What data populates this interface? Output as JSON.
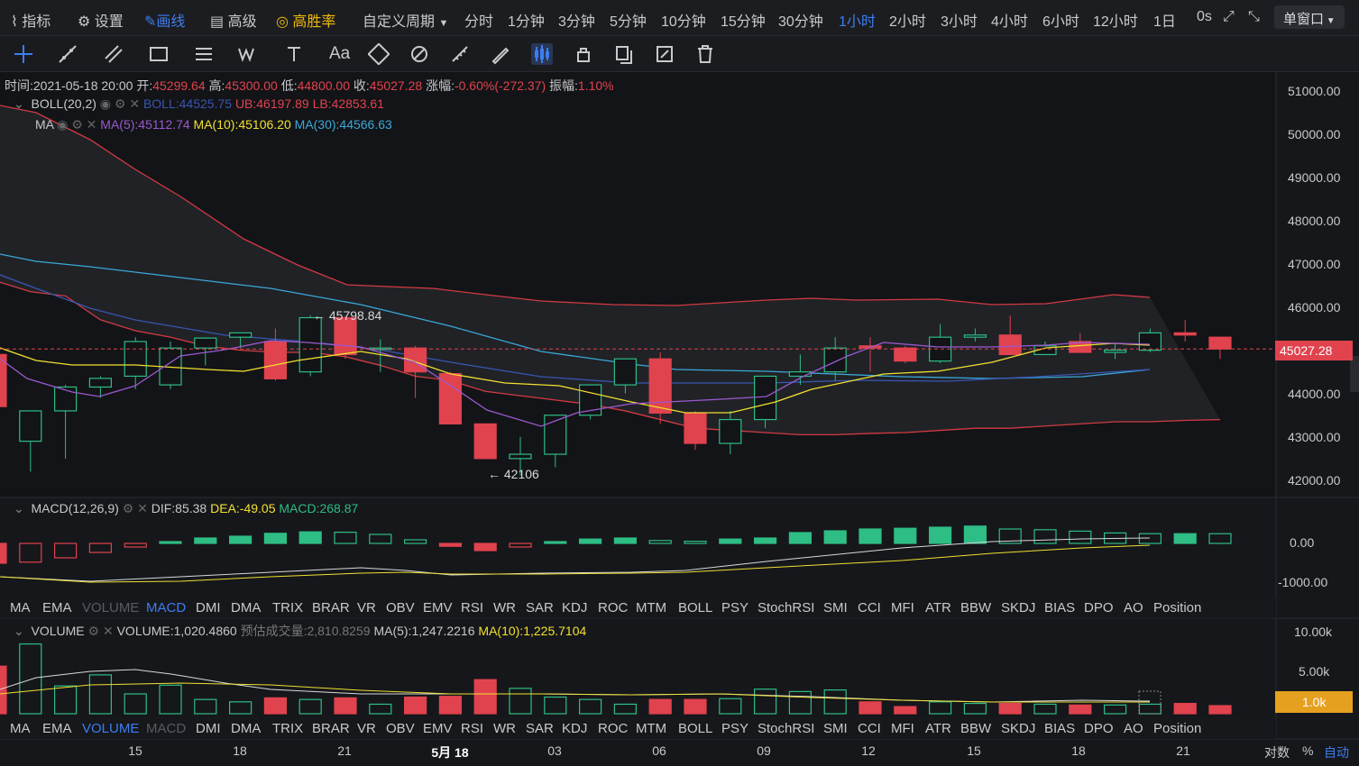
{
  "toolbar": {
    "indicator": "指标",
    "settings": "设置",
    "draw": "画线",
    "advanced": "高级",
    "winrate": "高胜率",
    "custom_period": "自定义周期",
    "periods": [
      "分时",
      "1分钟",
      "3分钟",
      "5分钟",
      "10分钟",
      "15分钟",
      "30分钟",
      "1小时",
      "2小时",
      "3小时",
      "4小时",
      "6小时",
      "12小时",
      "1日"
    ],
    "active_period": "1小时",
    "countdown": "0s",
    "window_mode": "单窗口"
  },
  "ohlc": {
    "time_label": "时间:",
    "time": "2021-05-18 20:00",
    "open_label": "开:",
    "open": "45299.64",
    "high_label": "高:",
    "high": "45300.00",
    "low_label": "低:",
    "low": "44800.00",
    "close_label": "收:",
    "close": "45027.28",
    "change_label": "涨幅:",
    "change": "-0.60%(-272.37)",
    "amplitude_label": "振幅:",
    "amplitude": "1.10%"
  },
  "boll_legend": {
    "name": "BOLL(20,2)",
    "mid": "BOLL:44525.75",
    "ub": "UB:46197.89",
    "lb": "LB:42853.61"
  },
  "ma_legend": {
    "name": "MA",
    "ma5": "MA(5):45112.74",
    "ma10": "MA(10):45106.20",
    "ma30": "MA(30):44566.63"
  },
  "macd_legend": {
    "name": "MACD(12,26,9)",
    "dif": "DIF:85.38",
    "dea": "DEA:-49.05",
    "macd": "MACD:268.87"
  },
  "volume_legend": {
    "name": "VOLUME",
    "vol": "VOLUME:1,020.4860",
    "est": "预估成交量:2,810.8259",
    "ma5": "MA(5):1,247.2216",
    "ma10": "MA(10):1,225.7104"
  },
  "indicators": [
    "MA",
    "EMA",
    "VOLUME",
    "MACD",
    "DMI",
    "DMA",
    "TRIX",
    "BRAR",
    "VR",
    "OBV",
    "EMV",
    "RSI",
    "WR",
    "SAR",
    "KDJ",
    "ROC",
    "MTM",
    "BOLL",
    "PSY",
    "StochRSI",
    "SMI",
    "CCI",
    "MFI",
    "ATR",
    "BBW",
    "SKDJ",
    "BIAS",
    "DPO",
    "AO",
    "Position"
  ],
  "price_axis": [
    "51000.00",
    "50000.00",
    "49000.00",
    "48000.00",
    "47000.00",
    "46000.00",
    "45000.00",
    "44000.00",
    "43000.00",
    "42000.00"
  ],
  "current_price": "45027.28",
  "macd_axis": [
    "0.00",
    "-1000.00"
  ],
  "vol_axis": [
    "10.00k",
    "5.00k"
  ],
  "current_vol": "1.0k",
  "annotations": {
    "high": "← 45798.84",
    "low": "← 42106"
  },
  "time_axis": [
    "15",
    "18",
    "21",
    "5月 18",
    "03",
    "06",
    "09",
    "12",
    "15",
    "18",
    "21"
  ],
  "footer": {
    "log": "对数",
    "percent": "%",
    "auto": "自动"
  },
  "colors": {
    "up": "#2ebd85",
    "down": "#e0434e",
    "accent": "#3d7df0",
    "gold": "#f0b90b"
  },
  "chart_data": {
    "type": "candlestick",
    "interval": "1小时",
    "candles": [
      [
        44900,
        45000,
        43600,
        43700
      ],
      [
        42900,
        43600,
        42200,
        43600
      ],
      [
        43600,
        44200,
        42500,
        44150
      ],
      [
        44150,
        44400,
        43900,
        44350
      ],
      [
        44400,
        45300,
        44100,
        45200
      ],
      [
        44200,
        45200,
        44100,
        45050
      ],
      [
        45050,
        45300,
        44650,
        45280
      ],
      [
        45300,
        45350,
        45050,
        45400
      ],
      [
        45200,
        45500,
        44300,
        44340
      ],
      [
        44500,
        45800,
        44400,
        45750
      ],
      [
        45750,
        45798.84,
        44800,
        44900
      ],
      [
        45050,
        45250,
        44500,
        45050
      ],
      [
        45050,
        45100,
        43900,
        44500
      ],
      [
        44460,
        44500,
        43300,
        43300
      ],
      [
        43300,
        43000,
        42500,
        42500
      ],
      [
        42500,
        43000,
        42106,
        42600
      ],
      [
        42600,
        43400,
        42300,
        43500
      ],
      [
        43500,
        44200,
        43400,
        44200
      ],
      [
        44200,
        44800,
        44000,
        44800
      ],
      [
        44800,
        44950,
        43300,
        43550
      ],
      [
        43550,
        43600,
        42700,
        42850
      ],
      [
        42850,
        43600,
        42600,
        43400
      ],
      [
        43400,
        44400,
        43200,
        44400
      ],
      [
        44400,
        44900,
        44200,
        44500
      ],
      [
        44500,
        45300,
        44300,
        45050
      ],
      [
        45100,
        45300,
        44500,
        45050
      ],
      [
        45050,
        45100,
        44700,
        44750
      ],
      [
        44750,
        45600,
        44700,
        45300
      ],
      [
        45300,
        45500,
        45200,
        45350
      ],
      [
        45350,
        45800,
        44900,
        44900
      ],
      [
        44900,
        45200,
        44900,
        45100
      ],
      [
        45200,
        45400,
        44950,
        44950
      ],
      [
        44950,
        45150,
        44800,
        45000
      ],
      [
        45000,
        45500,
        44950,
        45400
      ],
      [
        45400,
        45700,
        45200,
        45350
      ],
      [
        45300,
        45300,
        44800,
        45027.28
      ]
    ],
    "boll_ub": [
      46600,
      46350,
      46250,
      45700,
      45450,
      45300,
      45100,
      45000,
      44950,
      44950,
      44850,
      44650,
      44400,
      44300,
      44050,
      43950,
      43850,
      43750,
      43600,
      43400,
      43200,
      43150,
      43100,
      43050,
      43050,
      43080,
      43100,
      43150,
      43200,
      43200,
      43250,
      43300,
      43350,
      43350,
      43380,
      43400
    ],
    "macd_hist": [
      -550,
      -520,
      -400,
      -250,
      -100,
      50,
      150,
      200,
      280,
      320,
      310,
      250,
      100,
      -80,
      -200,
      -100,
      50,
      120,
      150,
      80,
      60,
      120,
      150,
      300,
      350,
      400,
      420,
      450,
      480,
      400,
      380,
      340,
      290,
      270,
      270,
      268.87
    ],
    "volume": [
      6000,
      8800,
      3500,
      4900,
      2500,
      3600,
      1800,
      1500,
      2000,
      1800,
      2000,
      1200,
      2100,
      2200,
      4300,
      3200,
      2100,
      1800,
      1200,
      1800,
      1800,
      1900,
      3100,
      2800,
      3000,
      1500,
      900,
      1500,
      1300,
      1300,
      1200,
      1100,
      1100,
      1200,
      1300,
      1020.486
    ]
  }
}
